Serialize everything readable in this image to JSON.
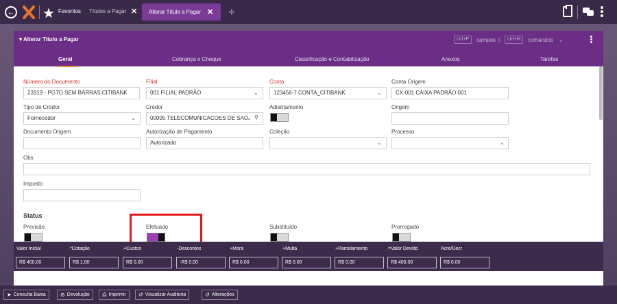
{
  "topbar": {
    "favorites_label": "Favoritos",
    "tabs": [
      {
        "label": "Títulos a Pagar",
        "active": false
      },
      {
        "label": "Alterar Título a Pagar",
        "active": true
      }
    ]
  },
  "panel": {
    "title": "Alterar Título a Pagar",
    "kbd_fields": "ctrl+P",
    "fields_label": "campos",
    "kbd_commands": "ctrl+M",
    "commands_label": "comandos",
    "tabs": [
      "Geral",
      "Cobrança e Cheque",
      "Classificação e Contabilização",
      "Anexos",
      "Tarefas"
    ]
  },
  "form": {
    "numero_documento": {
      "label": "Número do Documento",
      "value": "23319 - PGTO SEM BARRAS CITIBANK"
    },
    "filial": {
      "label": "Filial",
      "value": "001 FILIAL PADRÃO"
    },
    "conta": {
      "label": "Conta",
      "value": "123456-7 CONTA_CITIBANK"
    },
    "conta_origem": {
      "label": "Conta Origem",
      "value": "CX-001 CAIXA PADRÃO 001"
    },
    "tipo_credor": {
      "label": "Tipo de Credor",
      "value": "Fornecedor"
    },
    "credor": {
      "label": "Credor",
      "value": "00005 TELECOMUNICACOES DE SAO"
    },
    "adiantamento": {
      "label": "Adiantamento"
    },
    "origem": {
      "label": "Origem",
      "value": ""
    },
    "documento_origem": {
      "label": "Documento Origem",
      "value": ""
    },
    "autorizacao_pagamento": {
      "label": "Autorização de Pagamento",
      "value": "Autorizado"
    },
    "colecao": {
      "label": "Coleção",
      "value": ""
    },
    "processo": {
      "label": "Processo",
      "value": ""
    },
    "obs": {
      "label": "Obs",
      "value": ""
    },
    "imposto": {
      "label": "Imposto",
      "value": ""
    }
  },
  "status": {
    "heading": "Status",
    "items": [
      {
        "label": "Previsão",
        "on": false
      },
      {
        "label": "Efetuado",
        "on": true
      },
      {
        "label": "Substituído",
        "on": false
      },
      {
        "label": "Prorrogado",
        "on": false
      }
    ]
  },
  "totals": [
    {
      "label": "Valor Inicial",
      "value": "R$ 400,00"
    },
    {
      "label": "*Cotação",
      "value": "R$ 1,00"
    },
    {
      "label": "+Custos",
      "value": "R$ 0,00"
    },
    {
      "label": "-Descontos",
      "value": "-R$ 0,00"
    },
    {
      "label": "+Mora",
      "value": "R$ 0,00"
    },
    {
      "label": "+Multa",
      "value": "R$ 0,00"
    },
    {
      "label": "+Parcelamento",
      "value": "R$ 0,00"
    },
    {
      "label": "=Valor Devido",
      "value": "R$ 400,00"
    },
    {
      "label": "Acre/Decr",
      "value": "R$ 0,00"
    }
  ],
  "bottom_buttons": [
    {
      "label": "Consulta Baixa",
      "icon": "circle-arrow-icon"
    },
    {
      "label": "Devolução",
      "icon": "ban-icon"
    },
    {
      "label": "Imprimir",
      "icon": "printer-icon"
    },
    {
      "label": "Visualizar Auditoria",
      "icon": "history-icon"
    },
    {
      "label": "Alterações",
      "icon": "history-icon"
    }
  ],
  "colors": {
    "purple": "#6b2d86",
    "dark": "#3c2b4b",
    "required": "#d9342b",
    "highlight": "#e0161b",
    "accent": "#e88a3a"
  }
}
